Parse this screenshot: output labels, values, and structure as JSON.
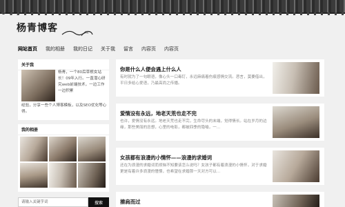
{
  "site": {
    "logo_text": "杨青博客"
  },
  "nav": {
    "items": [
      "网站首页",
      "我的相册",
      "我的日记",
      "关于我",
      "留言",
      "内容页",
      "内容页"
    ]
  },
  "about": {
    "title": "关于我",
    "text_line1": "杨青，一个80后草根女站长！09年入行。一直潜心研究web前端技术，一边工作一边积累",
    "text_line2": "经验，分享一些个人博客模板，以及SEO优化等心得。"
  },
  "album": {
    "title": "我的相册"
  },
  "search": {
    "placeholder": "请输入关键字词",
    "button_label": "搜索"
  },
  "posts": [
    {
      "title": "你是什么人便会遇上什么人",
      "excerpt": "有时就为了一句眼语，像心头一口毒钉，永远麻痛着伤痕感情交流。恶言，莫要借出，平日多给心爱语，乃最高尚之传播。"
    },
    {
      "title": "爱情没有永远，地老天荒也走不完",
      "excerpt": "也许，爱情没有永远。地老天荒也走不完，生命尽头的末端，觉得情长。站在岁月的边缘，那些美丽的念想，心里的电影，都被四季的隐喻，一..."
    },
    {
      "title": "女孩都有浪漫的小情怀——浪漫的求婚词",
      "excerpt": "还在为浪漫的求婚词而烦恼不知要该怎么说吗？女孩子都有着浪漫的小情怀，对于求婚更是有着许多浪漫的憧憬，也希望在求婚那一天对方可以..."
    },
    {
      "title": "擦肩而过",
      "excerpt": ""
    }
  ]
}
